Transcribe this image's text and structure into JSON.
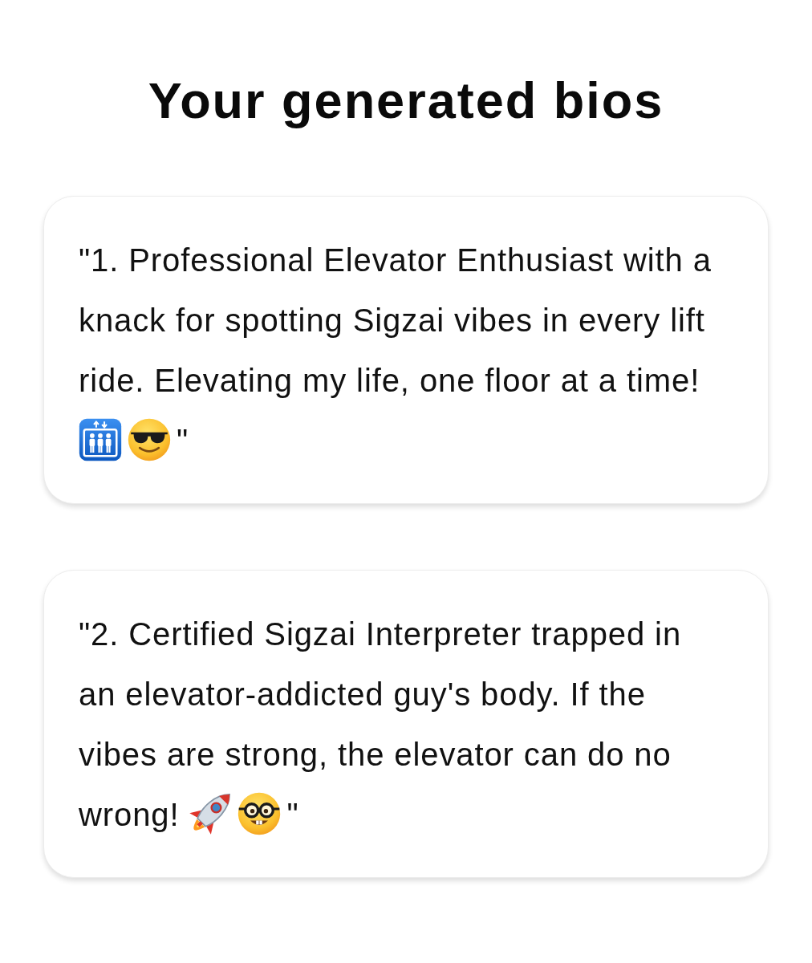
{
  "title": "Your generated bios",
  "bios": [
    {
      "text": "\"1. Professional Elevator Enthusiast with a knack for spotting Sigzai vibes in every lift ride. Elevating my life, one floor at a time!",
      "emojis": [
        {
          "kind": "elevator"
        },
        {
          "kind": "sunglasses"
        }
      ],
      "closing": "\""
    },
    {
      "text": "\"2. Certified Sigzai Interpreter trapped in an elevator-addicted guy's body. If the vibes are strong, the elevator can do no wrong!",
      "emojis": [
        {
          "kind": "rocket"
        },
        {
          "kind": "nerd"
        }
      ],
      "closing": "\""
    }
  ]
}
